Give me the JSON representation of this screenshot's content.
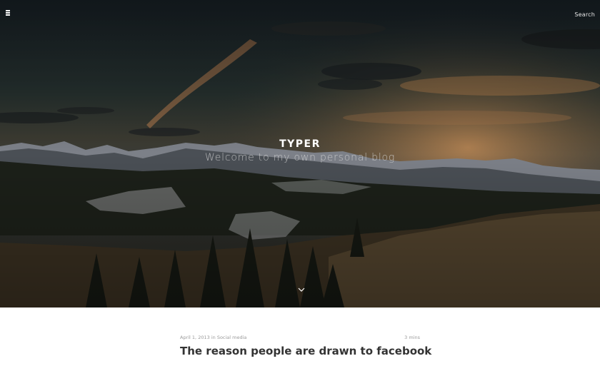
{
  "header": {
    "menu_icon": "hamburger-icon",
    "search_label": "Search"
  },
  "hero": {
    "title": "TYPER",
    "tagline": "Welcome to my own personal blog",
    "scroll_icon": "chevron-down-icon"
  },
  "post": {
    "date": "April 1, 2013",
    "in_label": "in",
    "category": "Social media",
    "read_time": "3 mins",
    "title": "The reason people are drawn to facebook"
  },
  "colors": {
    "hero_dark": "#1a2329",
    "sky_glow": "#c9925a",
    "title_text": "#333333",
    "meta_text": "#9a9a9a"
  }
}
